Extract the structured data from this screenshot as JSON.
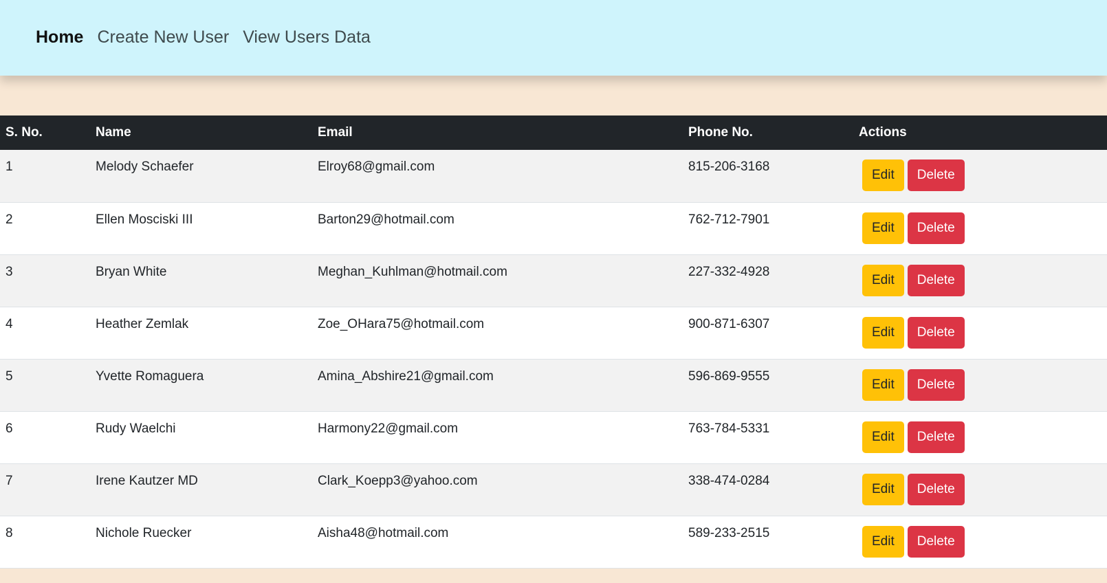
{
  "nav": {
    "items": [
      {
        "label": "Home",
        "active": true
      },
      {
        "label": "Create New User",
        "active": false
      },
      {
        "label": "View Users Data",
        "active": false
      }
    ]
  },
  "table": {
    "headers": [
      "S. No.",
      "Name",
      "Email",
      "Phone No.",
      "Actions"
    ],
    "edit_label": "Edit",
    "delete_label": "Delete",
    "rows": [
      {
        "sno": "1",
        "name": "Melody Schaefer",
        "email": "Elroy68@gmail.com",
        "phone": "815-206-3168"
      },
      {
        "sno": "2",
        "name": "Ellen Mosciski III",
        "email": "Barton29@hotmail.com",
        "phone": "762-712-7901"
      },
      {
        "sno": "3",
        "name": "Bryan White",
        "email": "Meghan_Kuhlman@hotmail.com",
        "phone": "227-332-4928"
      },
      {
        "sno": "4",
        "name": "Heather Zemlak",
        "email": "Zoe_OHara75@hotmail.com",
        "phone": "900-871-6307"
      },
      {
        "sno": "5",
        "name": "Yvette Romaguera",
        "email": "Amina_Abshire21@gmail.com",
        "phone": "596-869-9555"
      },
      {
        "sno": "6",
        "name": "Rudy Waelchi",
        "email": "Harmony22@gmail.com",
        "phone": "763-784-5331"
      },
      {
        "sno": "7",
        "name": "Irene Kautzer MD",
        "email": "Clark_Koepp3@yahoo.com",
        "phone": "338-474-0284"
      },
      {
        "sno": "8",
        "name": "Nichole Ruecker",
        "email": "Aisha48@hotmail.com",
        "phone": "589-233-2515"
      }
    ]
  },
  "colors": {
    "navbar_bg": "#cff4fc",
    "page_bg": "#f8e7d4",
    "header_bg": "#212529",
    "edit_button": "#ffc107",
    "delete_button": "#dc3545"
  }
}
